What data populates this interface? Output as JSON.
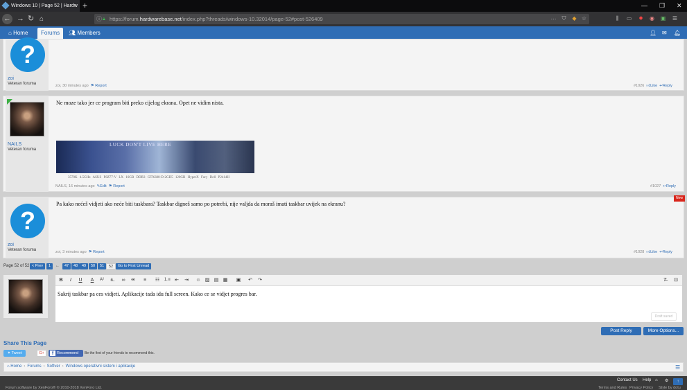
{
  "browser": {
    "tab_title": "Windows 10 | Page 52 | Hardw",
    "tab_close": "×",
    "new_tab": "+",
    "url_host": "https://forum.",
    "url_domain": "hardwarebase.net",
    "url_path": "/index.php?threads/windows-10.32014/page-52#post-526409",
    "url_more": "···"
  },
  "site_nav": {
    "home": "Home",
    "forums": "Forums",
    "members": "Members"
  },
  "posts": [
    {
      "username": "zoi",
      "user_title": "Veteran foruma",
      "avatar_glyph": "?",
      "message": "",
      "meta_author_time": "zoi, 30 minutes ago",
      "report": "Report",
      "number": "#1026",
      "like": "Like",
      "reply": "Reply"
    },
    {
      "username": "NAILS",
      "user_title": "Veteran foruma",
      "message": "Ne moze tako jer ce program biti preko cijelog ekrana. Opet ne vidim nista.",
      "banner_text": "LUCK DON'T LIVE HERE",
      "specs": "3570K 4.5GHz    ASUS P8Z77-V LX    16GB DDR3    GTX680-D-2GD5    120GB HyperX Fury    Dell P2414H",
      "meta_author_time": "NAILS, 16 minutes ago",
      "edit": "Edit",
      "report": "Report",
      "number": "#1027",
      "reply": "Reply"
    },
    {
      "username": "zoi",
      "user_title": "Veteran foruma",
      "avatar_glyph": "?",
      "new_badge": "New",
      "message": "Pa kako nećeš vidjeti ako neće biti taskbara? Taskbar digneš samo po potrebi, nije valjda da moraš imati taskbar uvijek na ekranu?",
      "meta_author_time": "zoi, 3 minutes ago",
      "report": "Report",
      "number": "#1028",
      "like": "Like",
      "reply": "Reply"
    }
  ],
  "pagination": {
    "label": "Page 52 of 52",
    "prev": "< Prev",
    "first": "1",
    "ellipsis": "←",
    "pages": [
      "47",
      "48",
      "49",
      "50",
      "51"
    ],
    "current": "52",
    "go_first_unread": "Go to First Unread"
  },
  "editor": {
    "text": "Sakrij taskbar pa ces vidjeti. Aplikacije tada idu full screen. Kako ce se  vidjet progres bar.",
    "draft_saved": "Draft saved",
    "post_reply": "Post Reply",
    "more_options": "More Options..."
  },
  "share": {
    "title": "Share This Page",
    "tweet": "Tweet",
    "gplus": "G+",
    "fb_recommend": "Recommend",
    "fb_text": "Be the first of your friends to recommend this."
  },
  "breadcrumb": [
    "Home",
    "Forums",
    "Softver",
    "Windows operativni sistem i aplikacije"
  ],
  "footer": {
    "contact": "Contact Us",
    "help": "Help",
    "copyright": "Forum software by XenForo® © 2010-2018 XenForo Ltd.",
    "terms": "Terms and Rules",
    "privacy": "Privacy Policy",
    "style": "Style by dotu"
  },
  "colors": {
    "brand": "#2f6db5",
    "new_badge": "#d9261c"
  }
}
